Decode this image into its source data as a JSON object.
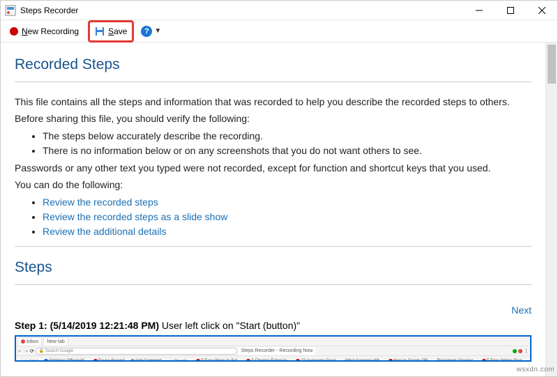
{
  "window": {
    "title": "Steps Recorder"
  },
  "toolbar": {
    "new_recording": "ew Recording",
    "new_recording_prefix": "N",
    "save": "ave",
    "save_prefix": "S"
  },
  "headings": {
    "recorded_steps": "Recorded Steps",
    "steps": "Steps"
  },
  "intro": {
    "p1": "This file contains all the steps and information that was recorded to help you describe the recorded steps to others.",
    "p2": "Before sharing this file, you should verify the following:",
    "b1": "The steps below accurately describe the recording.",
    "b2": "There is no information below or on any screenshots that you do not want others to see.",
    "p3": "Passwords or any other text you typed were not recorded, except for function and shortcut keys that you used.",
    "p4": "You can do the following:",
    "l1": "Review the recorded steps",
    "l2": "Review the recorded steps as a slide show",
    "l3": "Review the additional details"
  },
  "nav": {
    "next": "Next"
  },
  "step1": {
    "label": "Step 1:",
    "timestamp": "(5/14/2019 12:21:48 PM)",
    "desc": " User left click on \"Start (button)\""
  },
  "watermark": "wsxdn.com"
}
